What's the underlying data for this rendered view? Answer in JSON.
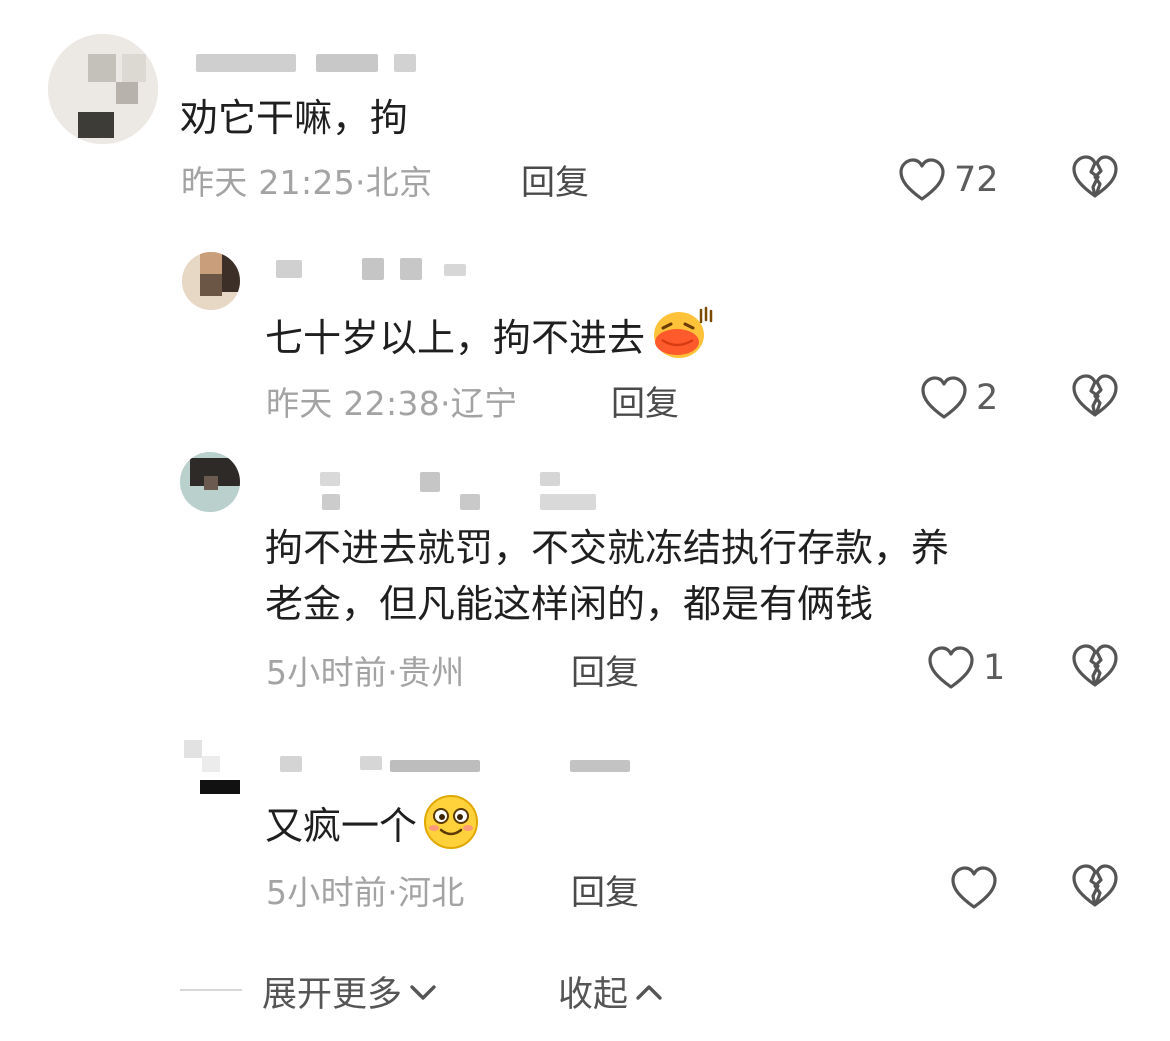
{
  "comments": [
    {
      "text": "劝它干嘛，拘",
      "time": "昨天 21:25",
      "location": "北京",
      "reply_label": "回复",
      "likes": "72",
      "emoji": ""
    },
    {
      "text": "七十岁以上，拘不进去",
      "time": "昨天 22:38",
      "location": "辽宁",
      "reply_label": "回复",
      "likes": "2",
      "emoji": "face-with-laughing-lips"
    },
    {
      "text_line1": "拘不进去就罚，不交就冻结执行存款，养",
      "text_line2": "老金，但凡能这样闲的，都是有俩钱",
      "time": "5小时前",
      "location": "贵州",
      "reply_label": "回复",
      "likes": "1",
      "emoji": ""
    },
    {
      "text": "又疯一个",
      "time": "5小时前",
      "location": "河北",
      "reply_label": "回复",
      "likes": "",
      "emoji": "smiling-face"
    }
  ],
  "meta_separator": "·",
  "footer": {
    "expand_label": "展开更多",
    "collapse_label": "收起"
  },
  "icons": {
    "like": "heart-outline-icon",
    "dislike": "broken-heart-icon",
    "expand": "chevron-down-icon",
    "collapse": "chevron-up-icon"
  },
  "colors": {
    "text": "#1f1f1f",
    "meta": "#a3a3a3",
    "icon": "#555555"
  }
}
